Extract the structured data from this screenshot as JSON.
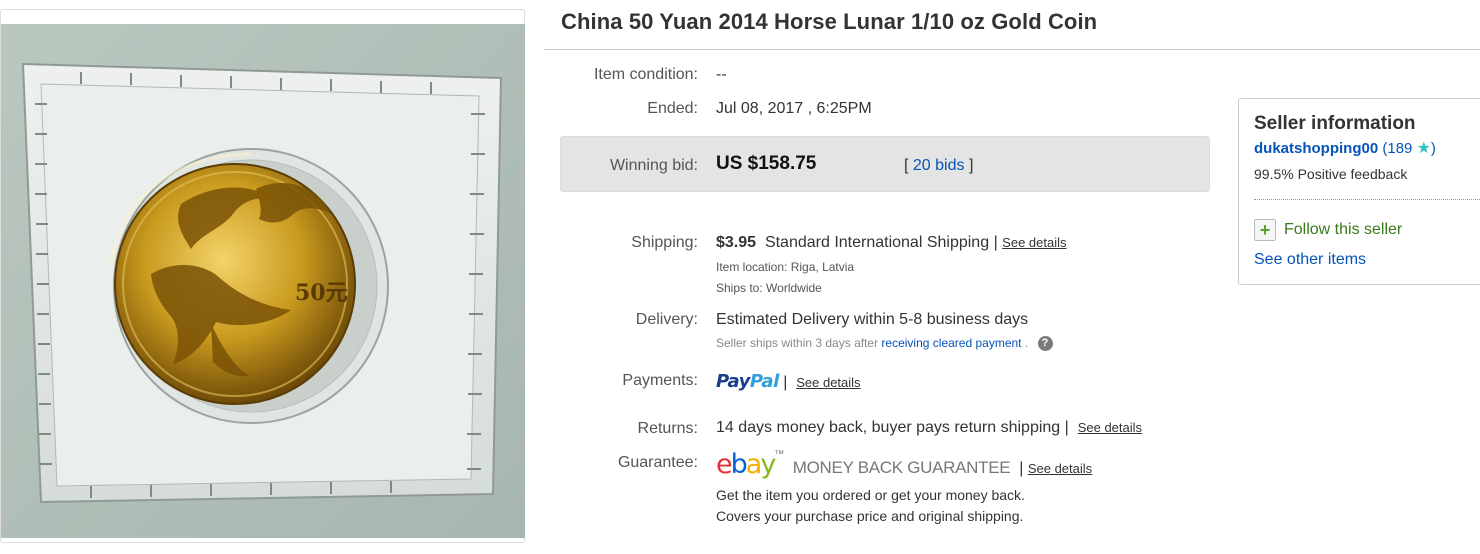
{
  "listing": {
    "title": "China 50 Yuan 2014 Horse Lunar 1/10 oz Gold Coin"
  },
  "details": {
    "condition_label": "Item condition:",
    "condition_value": "--",
    "ended_label": "Ended:",
    "ended_value": "Jul 08, 2017 , 6:25PM",
    "bid_label": "Winning bid:",
    "bid_price": "US $158.75",
    "bid_open": "[",
    "bid_count": "20 bids",
    "bid_close": "]",
    "shipping_label": "Shipping:",
    "shipping_cost": "$3.95",
    "shipping_method": "Standard International Shipping",
    "shipping_see_details": "See details",
    "location_label": "Item location:",
    "location_value": "Riga, Latvia",
    "ships_label": "Ships to:",
    "ships_value": "Worldwide",
    "delivery_label": "Delivery:",
    "delivery_value": "Estimated Delivery within 5-8 business days",
    "delivery_note": "Seller ships within 3 days after",
    "delivery_note_link": "receiving cleared payment",
    "delivery_note_end": ".",
    "help_icon_glyph": "?",
    "payments_label": "Payments:",
    "paypal_part1": "Pay",
    "paypal_part2": "Pal",
    "payments_see_details": "See details",
    "returns_label": "Returns:",
    "returns_value": "14 days money back, buyer pays return shipping",
    "returns_see_details": "See details",
    "guarantee_label": "Guarantee:",
    "ebay_e": "e",
    "ebay_b": "b",
    "ebay_a": "a",
    "ebay_y": "y",
    "ebay_tm": "™",
    "guarantee_badge": "MONEY BACK GUARANTEE",
    "guarantee_see_details": "See details",
    "guarantee_line1": "Get the item you ordered or get your money back.",
    "guarantee_line2": "Covers your purchase price and original shipping."
  },
  "seller": {
    "heading": "Seller information",
    "username": "dukatshopping00",
    "feedback_open": "(",
    "feedback_score": "189",
    "feedback_close": ")",
    "star_icon": "star-icon",
    "positive": "99.5% Positive feedback",
    "follow_label": "Follow this seller",
    "other_items": "See other items"
  },
  "image": {
    "coin_value_mark": "50元"
  },
  "colors": {
    "link": "#0654ba",
    "bid_box": "#e4e4e4",
    "gold": "#c8a22c",
    "follow_green": "#3a7a1a"
  }
}
